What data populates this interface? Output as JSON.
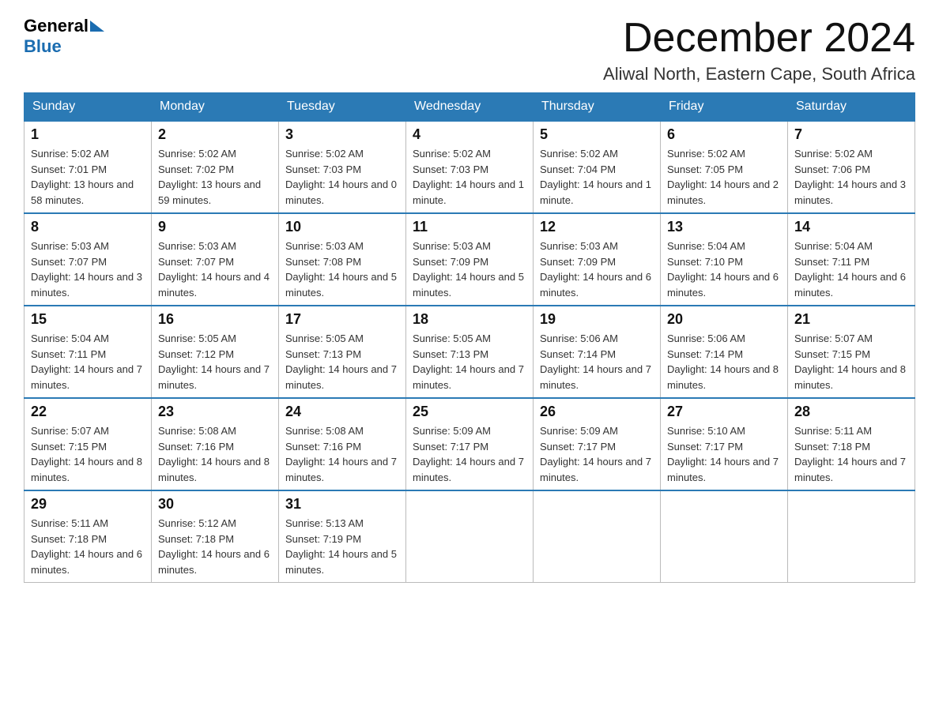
{
  "header": {
    "logo_general": "General",
    "logo_blue": "Blue",
    "month_title": "December 2024",
    "location": "Aliwal North, Eastern Cape, South Africa"
  },
  "weekdays": [
    "Sunday",
    "Monday",
    "Tuesday",
    "Wednesday",
    "Thursday",
    "Friday",
    "Saturday"
  ],
  "weeks": [
    [
      {
        "day": "1",
        "sunrise": "5:02 AM",
        "sunset": "7:01 PM",
        "daylight": "13 hours and 58 minutes."
      },
      {
        "day": "2",
        "sunrise": "5:02 AM",
        "sunset": "7:02 PM",
        "daylight": "13 hours and 59 minutes."
      },
      {
        "day": "3",
        "sunrise": "5:02 AM",
        "sunset": "7:03 PM",
        "daylight": "14 hours and 0 minutes."
      },
      {
        "day": "4",
        "sunrise": "5:02 AM",
        "sunset": "7:03 PM",
        "daylight": "14 hours and 1 minute."
      },
      {
        "day": "5",
        "sunrise": "5:02 AM",
        "sunset": "7:04 PM",
        "daylight": "14 hours and 1 minute."
      },
      {
        "day": "6",
        "sunrise": "5:02 AM",
        "sunset": "7:05 PM",
        "daylight": "14 hours and 2 minutes."
      },
      {
        "day": "7",
        "sunrise": "5:02 AM",
        "sunset": "7:06 PM",
        "daylight": "14 hours and 3 minutes."
      }
    ],
    [
      {
        "day": "8",
        "sunrise": "5:03 AM",
        "sunset": "7:07 PM",
        "daylight": "14 hours and 3 minutes."
      },
      {
        "day": "9",
        "sunrise": "5:03 AM",
        "sunset": "7:07 PM",
        "daylight": "14 hours and 4 minutes."
      },
      {
        "day": "10",
        "sunrise": "5:03 AM",
        "sunset": "7:08 PM",
        "daylight": "14 hours and 5 minutes."
      },
      {
        "day": "11",
        "sunrise": "5:03 AM",
        "sunset": "7:09 PM",
        "daylight": "14 hours and 5 minutes."
      },
      {
        "day": "12",
        "sunrise": "5:03 AM",
        "sunset": "7:09 PM",
        "daylight": "14 hours and 6 minutes."
      },
      {
        "day": "13",
        "sunrise": "5:04 AM",
        "sunset": "7:10 PM",
        "daylight": "14 hours and 6 minutes."
      },
      {
        "day": "14",
        "sunrise": "5:04 AM",
        "sunset": "7:11 PM",
        "daylight": "14 hours and 6 minutes."
      }
    ],
    [
      {
        "day": "15",
        "sunrise": "5:04 AM",
        "sunset": "7:11 PM",
        "daylight": "14 hours and 7 minutes."
      },
      {
        "day": "16",
        "sunrise": "5:05 AM",
        "sunset": "7:12 PM",
        "daylight": "14 hours and 7 minutes."
      },
      {
        "day": "17",
        "sunrise": "5:05 AM",
        "sunset": "7:13 PM",
        "daylight": "14 hours and 7 minutes."
      },
      {
        "day": "18",
        "sunrise": "5:05 AM",
        "sunset": "7:13 PM",
        "daylight": "14 hours and 7 minutes."
      },
      {
        "day": "19",
        "sunrise": "5:06 AM",
        "sunset": "7:14 PM",
        "daylight": "14 hours and 7 minutes."
      },
      {
        "day": "20",
        "sunrise": "5:06 AM",
        "sunset": "7:14 PM",
        "daylight": "14 hours and 8 minutes."
      },
      {
        "day": "21",
        "sunrise": "5:07 AM",
        "sunset": "7:15 PM",
        "daylight": "14 hours and 8 minutes."
      }
    ],
    [
      {
        "day": "22",
        "sunrise": "5:07 AM",
        "sunset": "7:15 PM",
        "daylight": "14 hours and 8 minutes."
      },
      {
        "day": "23",
        "sunrise": "5:08 AM",
        "sunset": "7:16 PM",
        "daylight": "14 hours and 8 minutes."
      },
      {
        "day": "24",
        "sunrise": "5:08 AM",
        "sunset": "7:16 PM",
        "daylight": "14 hours and 7 minutes."
      },
      {
        "day": "25",
        "sunrise": "5:09 AM",
        "sunset": "7:17 PM",
        "daylight": "14 hours and 7 minutes."
      },
      {
        "day": "26",
        "sunrise": "5:09 AM",
        "sunset": "7:17 PM",
        "daylight": "14 hours and 7 minutes."
      },
      {
        "day": "27",
        "sunrise": "5:10 AM",
        "sunset": "7:17 PM",
        "daylight": "14 hours and 7 minutes."
      },
      {
        "day": "28",
        "sunrise": "5:11 AM",
        "sunset": "7:18 PM",
        "daylight": "14 hours and 7 minutes."
      }
    ],
    [
      {
        "day": "29",
        "sunrise": "5:11 AM",
        "sunset": "7:18 PM",
        "daylight": "14 hours and 6 minutes."
      },
      {
        "day": "30",
        "sunrise": "5:12 AM",
        "sunset": "7:18 PM",
        "daylight": "14 hours and 6 minutes."
      },
      {
        "day": "31",
        "sunrise": "5:13 AM",
        "sunset": "7:19 PM",
        "daylight": "14 hours and 5 minutes."
      },
      null,
      null,
      null,
      null
    ]
  ]
}
